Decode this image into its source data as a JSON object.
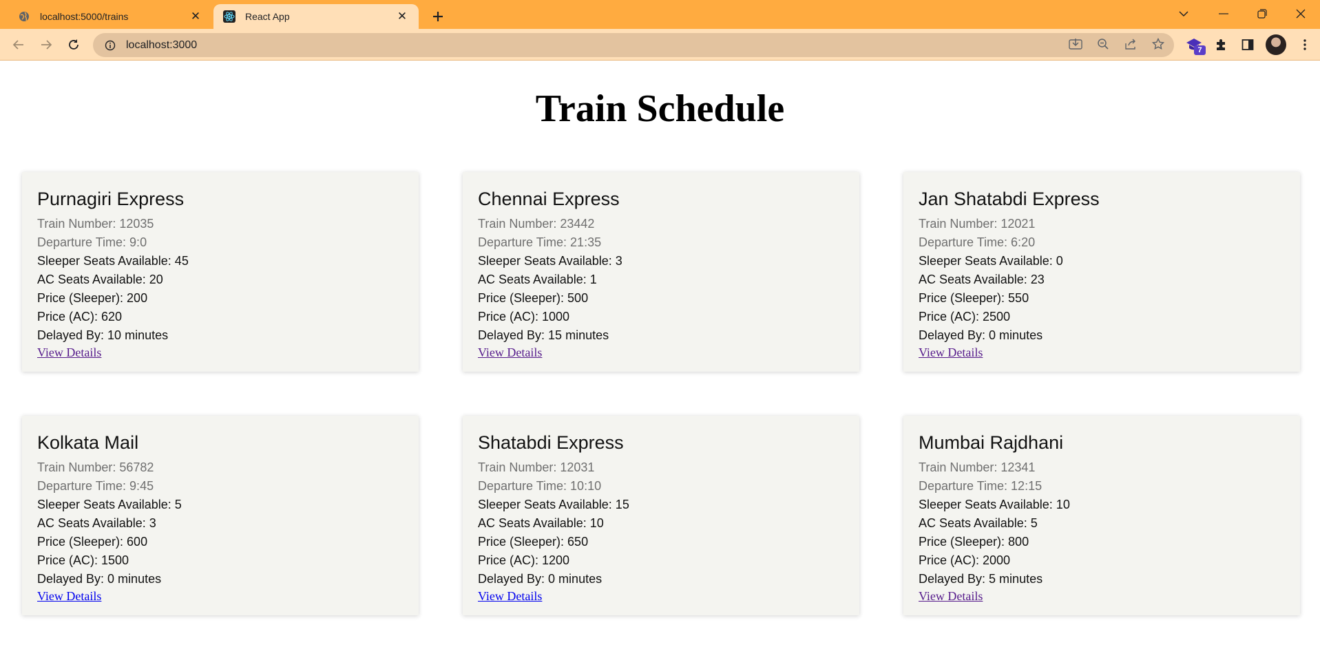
{
  "browser": {
    "tabs": [
      {
        "title": "localhost:5000/trains",
        "active": false
      },
      {
        "title": "React App",
        "active": true
      }
    ],
    "url": "localhost:3000",
    "extension_badge": "7"
  },
  "page": {
    "title": "Train Schedule"
  },
  "trains": [
    {
      "name": "Purnagiri Express",
      "number": "Train Number: 12035",
      "departure": "Departure Time: 9:0",
      "sleeper_seats": "Sleeper Seats Available: 45",
      "ac_seats": "AC Seats Available: 20",
      "price_sleeper": "Price (Sleeper): 200",
      "price_ac": "Price (AC): 620",
      "delay": "Delayed By: 10 minutes",
      "link": "View Details",
      "visited": true
    },
    {
      "name": "Chennai Express",
      "number": "Train Number: 23442",
      "departure": "Departure Time: 21:35",
      "sleeper_seats": "Sleeper Seats Available: 3",
      "ac_seats": "AC Seats Available: 1",
      "price_sleeper": "Price (Sleeper): 500",
      "price_ac": "Price (AC): 1000",
      "delay": "Delayed By: 15 minutes",
      "link": "View Details",
      "visited": true
    },
    {
      "name": "Jan Shatabdi Express",
      "number": "Train Number: 12021",
      "departure": "Departure Time: 6:20",
      "sleeper_seats": "Sleeper Seats Available: 0",
      "ac_seats": "AC Seats Available: 23",
      "price_sleeper": "Price (Sleeper): 550",
      "price_ac": "Price (AC): 2500",
      "delay": "Delayed By: 0 minutes",
      "link": "View Details",
      "visited": true
    },
    {
      "name": "Kolkata Mail",
      "number": "Train Number: 56782",
      "departure": "Departure Time: 9:45",
      "sleeper_seats": "Sleeper Seats Available: 5",
      "ac_seats": "AC Seats Available: 3",
      "price_sleeper": "Price (Sleeper): 600",
      "price_ac": "Price (AC): 1500",
      "delay": "Delayed By: 0 minutes",
      "link": "View Details",
      "visited": false
    },
    {
      "name": "Shatabdi Express",
      "number": "Train Number: 12031",
      "departure": "Departure Time: 10:10",
      "sleeper_seats": "Sleeper Seats Available: 15",
      "ac_seats": "AC Seats Available: 10",
      "price_sleeper": "Price (Sleeper): 650",
      "price_ac": "Price (AC): 1200",
      "delay": "Delayed By: 0 minutes",
      "link": "View Details",
      "visited": false
    },
    {
      "name": "Mumbai Rajdhani",
      "number": "Train Number: 12341",
      "departure": "Departure Time: 12:15",
      "sleeper_seats": "Sleeper Seats Available: 10",
      "ac_seats": "AC Seats Available: 5",
      "price_sleeper": "Price (Sleeper): 800",
      "price_ac": "Price (AC): 2000",
      "delay": "Delayed By: 5 minutes",
      "link": "View Details",
      "visited": true
    }
  ]
}
